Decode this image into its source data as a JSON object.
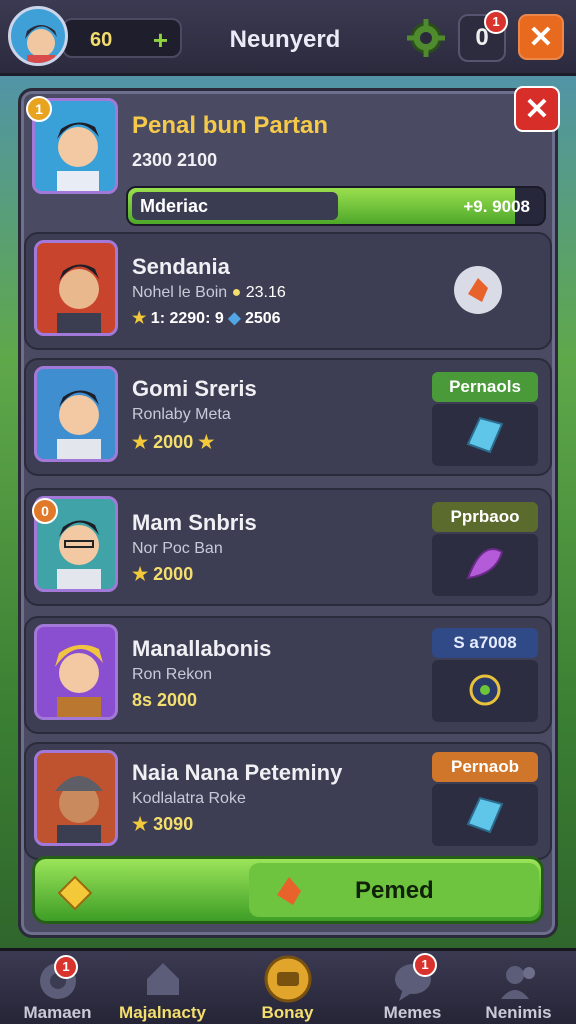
{
  "header": {
    "coins": "60",
    "plus": "+",
    "title": "Neunyerd",
    "notifications": "0",
    "notif_badge": "1",
    "close": "✕"
  },
  "panel_close": "✕",
  "featured": {
    "rank": "1",
    "name": "Penal bun Partan",
    "stats": "2300 2100",
    "progress_label": "Mderiac",
    "progress_value": "+9. 9008",
    "progress_fraction": 0.93
  },
  "cards": [
    {
      "name": "Sendania",
      "sub": "Nohel le Boin",
      "sub_value": "23.16",
      "stat1": "1: 2290: 9",
      "stat2": "2506",
      "tag": ""
    },
    {
      "name": "Gomi Sreris",
      "sub": "Ronlaby Meta",
      "stat1": "2000",
      "stat2": "",
      "tag": "Pernaols",
      "tag_color": "#4a9a3a"
    },
    {
      "name": "Mam Snbris",
      "sub": "Nor Poc Ban",
      "stat1": "2000",
      "stat2": "",
      "tag": "Pprbaoo",
      "tag_color": "#5a6b2d"
    },
    {
      "name": "Manallabonis",
      "sub": "Ron Rekon",
      "stat1": "8s 2000",
      "stat2": "",
      "tag": "S a7008",
      "tag_color": "#2f4a86"
    },
    {
      "name": "Naia Nana Peteminy",
      "sub": "Kodlalatra Roke",
      "stat1": "3090",
      "stat2": "",
      "tag": "Pernaob",
      "tag_color": "#d0762a"
    }
  ],
  "ranks": [
    "1",
    "",
    "",
    "0",
    "",
    ""
  ],
  "action_button": {
    "label": "Pemed"
  },
  "nav": [
    {
      "label": "Mamaen",
      "badge": "1"
    },
    {
      "label": "Majalnacty",
      "badge": ""
    },
    {
      "label": "Bonay",
      "badge": ""
    },
    {
      "label": "Memes",
      "badge": "1"
    },
    {
      "label": "Nenimis",
      "badge": ""
    }
  ],
  "colors": {
    "accent_green": "#6cc63a",
    "close_red": "#d72e2a",
    "gold": "#f3de6e"
  }
}
